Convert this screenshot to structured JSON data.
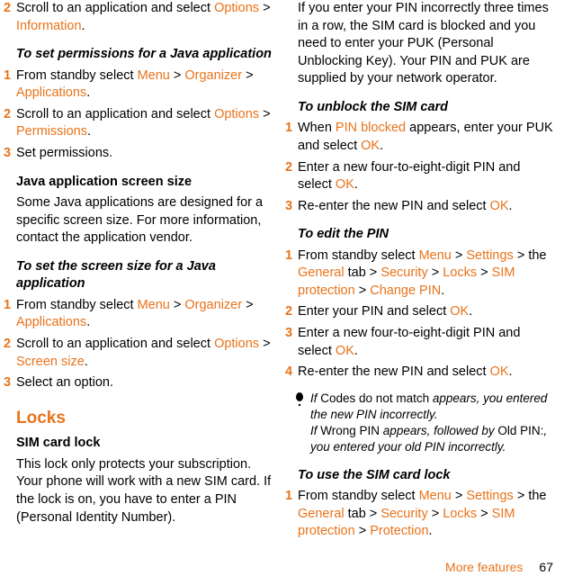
{
  "left": {
    "s1_num": "2",
    "s1_a": "Scroll to an application and select ",
    "s1_b": "Options",
    "s1_c": " > ",
    "s1_d": "Information",
    "s1_e": ".",
    "h1": "To set permissions for a Java application",
    "s2_num": "1",
    "s2_a": "From standby select ",
    "s2_b": "Menu",
    "s2_c": " > ",
    "s2_d": "Organizer",
    "s2_e": " > ",
    "s2_f": "Applications",
    "s2_g": ".",
    "s3_num": "2",
    "s3_a": "Scroll to an application and select ",
    "s3_b": "Options",
    "s3_c": " > ",
    "s3_d": "Permissions",
    "s3_e": ".",
    "s4_num": "3",
    "s4_a": "Set permissions.",
    "h2": "Java application screen size",
    "p1": "Some Java applications are designed for a specific screen size. For more information, contact the application vendor.",
    "h3": "To set the screen size for a Java application",
    "s5_num": "1",
    "s5_a": "From standby select ",
    "s5_b": "Menu",
    "s5_c": " > ",
    "s5_d": "Organizer",
    "s5_e": " > ",
    "s5_f": "Applications",
    "s5_g": ".",
    "s6_num": "2",
    "s6_a": "Scroll to an application and select ",
    "s6_b": "Options",
    "s6_c": " > ",
    "s6_d": "Screen size",
    "s6_e": ".",
    "s7_num": "3",
    "s7_a": "Select an option.",
    "h4": "Locks",
    "h5": "SIM card lock",
    "p2": "This lock only protects your subscription. Your phone will work with a new SIM card. If the lock is on, you have to enter a PIN (Personal Identity Number)."
  },
  "right": {
    "p1": "If you enter your PIN incorrectly three times in a row, the SIM card is blocked and you need to enter your PUK (Personal Unblocking Key). Your PIN and PUK are supplied by your network operator.",
    "h1": "To unblock the SIM card",
    "s1_num": "1",
    "s1_a": "When ",
    "s1_b": "PIN blocked",
    "s1_c": " appears, enter your PUK and select ",
    "s1_d": "OK",
    "s1_e": ".",
    "s2_num": "2",
    "s2_a": "Enter a new four-to-eight-digit PIN and select ",
    "s2_b": "OK",
    "s2_c": ".",
    "s3_num": "3",
    "s3_a": "Re-enter the new PIN and select ",
    "s3_b": "OK",
    "s3_c": ".",
    "h2": "To edit the PIN",
    "s4_num": "1",
    "s4_a": "From standby select ",
    "s4_b": "Menu",
    "s4_c": " > ",
    "s4_d": "Settings",
    "s4_e": " > the ",
    "s4_f": "General",
    "s4_g": " tab > ",
    "s4_h": "Security",
    "s4_i": " > ",
    "s4_j": "Locks",
    "s4_k": " > ",
    "s4_l": "SIM protection",
    "s4_m": " > ",
    "s4_n": "Change PIN",
    "s4_o": ".",
    "s5_num": "2",
    "s5_a": "Enter your PIN and select ",
    "s5_b": "OK",
    "s5_c": ".",
    "s6_num": "3",
    "s6_a": "Enter a new four-to-eight-digit PIN and select ",
    "s6_b": "OK",
    "s6_c": ".",
    "s7_num": "4",
    "s7_a": "Re-enter the new PIN and select ",
    "s7_b": "OK",
    "s7_c": ".",
    "note_a": "If ",
    "note_b": "Codes do not match",
    "note_c": " appears, you entered the new PIN incorrectly.",
    "note_d": "If ",
    "note_e": "Wrong PIN",
    "note_f": " appears, followed by ",
    "note_g": "Old PIN:",
    "note_h": ", you entered your old PIN incorrectly.",
    "h3": "To use the SIM card lock",
    "s8_num": "1",
    "s8_a": "From standby select ",
    "s8_b": "Menu",
    "s8_c": " > ",
    "s8_d": "Settings",
    "s8_e": " > the ",
    "s8_f": "General",
    "s8_g": " tab > ",
    "s8_h": "Security",
    "s8_i": " > ",
    "s8_j": "Locks",
    "s8_k": " > ",
    "s8_l": "SIM protection",
    "s8_m": " > ",
    "s8_n": "Protection",
    "s8_o": "."
  },
  "footer": {
    "section": "More features",
    "page": "67"
  }
}
